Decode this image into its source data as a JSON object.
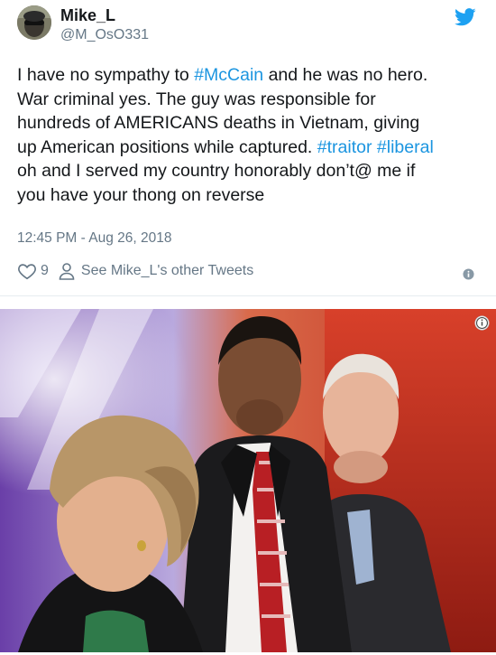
{
  "author": {
    "name": "Mike_L",
    "handle": "@M_OsO331"
  },
  "tweet": {
    "lines": [
      [
        {
          "t": "I have no sympathy to "
        },
        {
          "t": "#McCain",
          "tag": true
        },
        {
          "t": " and he was no hero."
        }
      ],
      [
        {
          "t": "War criminal yes. The guy was responsible for"
        }
      ],
      [
        {
          "t": "hundreds of AMERICANS deaths in Vietnam, giving"
        }
      ],
      [
        {
          "t": "up American positions while captured. "
        },
        {
          "t": "#traitor",
          "tag": true
        },
        {
          "t": " "
        },
        {
          "t": "#liberal",
          "tag": true
        }
      ],
      [
        {
          "t": "oh and I served my country honorably don’t@ me if"
        }
      ],
      [
        {
          "t": "you have your thong on reverse"
        }
      ]
    ],
    "timestamp": "12:45 PM - Aug 26, 2018",
    "like_count": "9",
    "other_tweets_label": "See Mike_L's other Tweets"
  },
  "colors": {
    "hashtag": "#1b95e0",
    "secondary_text": "#657786",
    "twitter_blue": "#1da1f2"
  },
  "icons": [
    "twitter-bird-icon",
    "heart-icon",
    "person-icon",
    "info-icon"
  ]
}
